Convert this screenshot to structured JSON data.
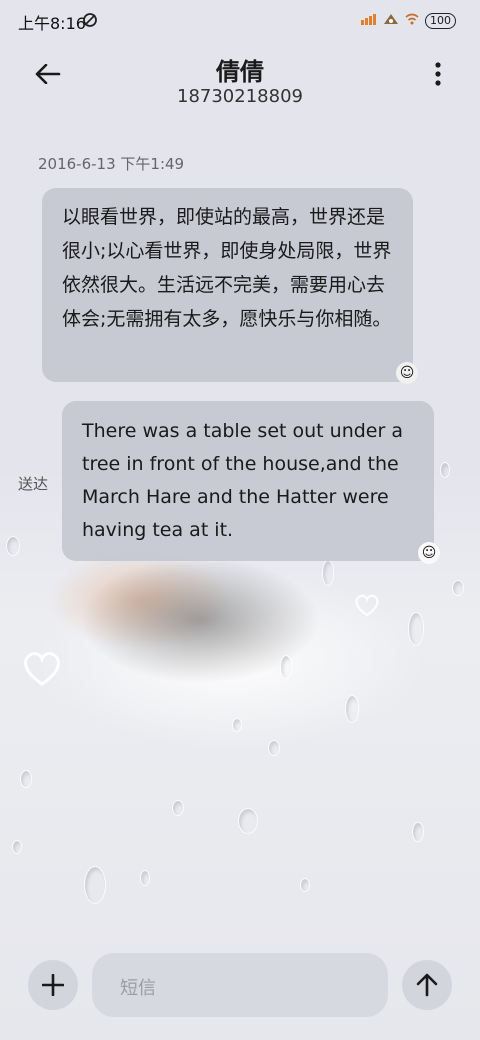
{
  "status_bar": {
    "time": "上午8:16",
    "battery": "100"
  },
  "header": {
    "contact_name": "倩倩",
    "phone_number": "18730218809"
  },
  "messages": [
    {
      "timestamp": "2016-6-13 下午1:49",
      "text": "以眼看世界，即使站的最高，世界还是很小;以心看世界，即使身处局限，世界依然很大。生活远不完美，需要用心去体会;无需拥有太多，愿快乐与你相随。"
    },
    {
      "text": "There was a table set out under a tree in front of the house,and the March Hare and the Hatter were having tea at it.",
      "status": "送达"
    }
  ],
  "compose": {
    "placeholder": "短信"
  },
  "icons": {
    "back": "arrow-left-icon",
    "menu": "more-vertical-icon",
    "add": "plus-icon",
    "send": "arrow-up-icon"
  }
}
